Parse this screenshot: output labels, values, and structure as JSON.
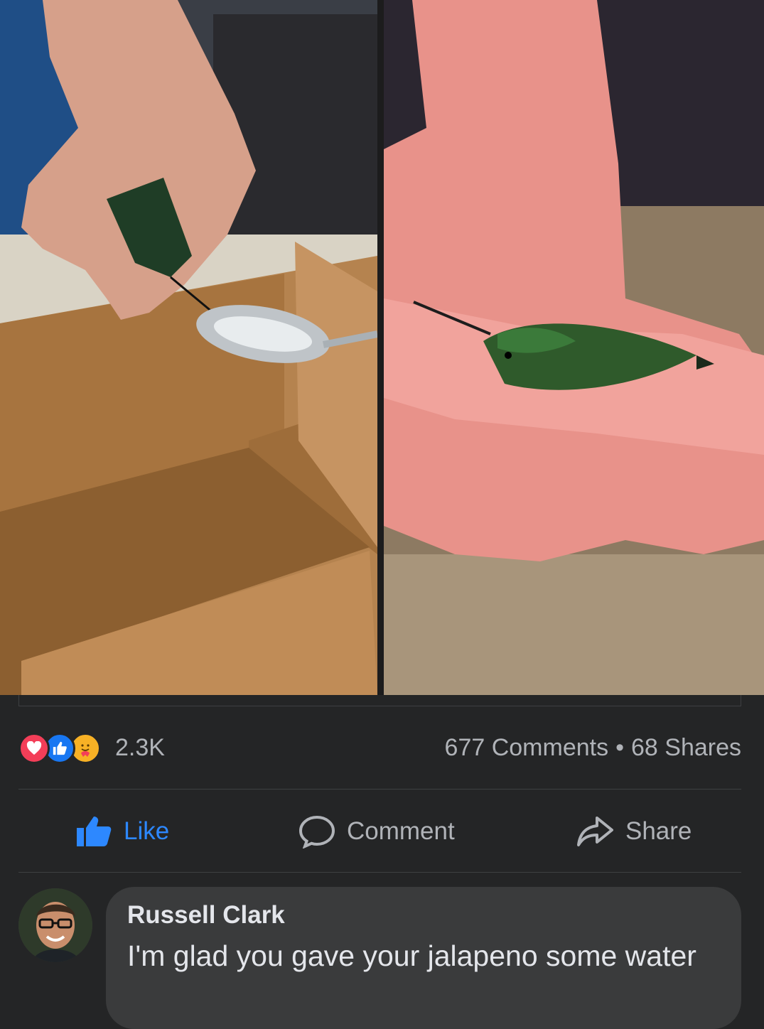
{
  "post": {
    "images": [
      {
        "description_icon": "hummingbird-spoon-photo-icon"
      },
      {
        "description_icon": "hummingbird-hand-photo-icon"
      }
    ]
  },
  "reactions": {
    "icons": [
      "love-reaction-icon",
      "like-reaction-icon",
      "care-reaction-icon"
    ],
    "count": "2.3K",
    "comments": "677 Comments",
    "separator": "•",
    "shares": "68 Shares"
  },
  "actions": {
    "like_label": "Like",
    "comment_label": "Comment",
    "share_label": "Share"
  },
  "comment": {
    "author": "Russell Clark",
    "text": "I'm glad you gave your jalapeno some water"
  },
  "colors": {
    "background": "#242526",
    "bubble": "#3a3b3c",
    "accent_like": "#2d88ff",
    "muted_text": "#b0b3b8",
    "love": "#f33e58",
    "care": "#f7b125"
  }
}
